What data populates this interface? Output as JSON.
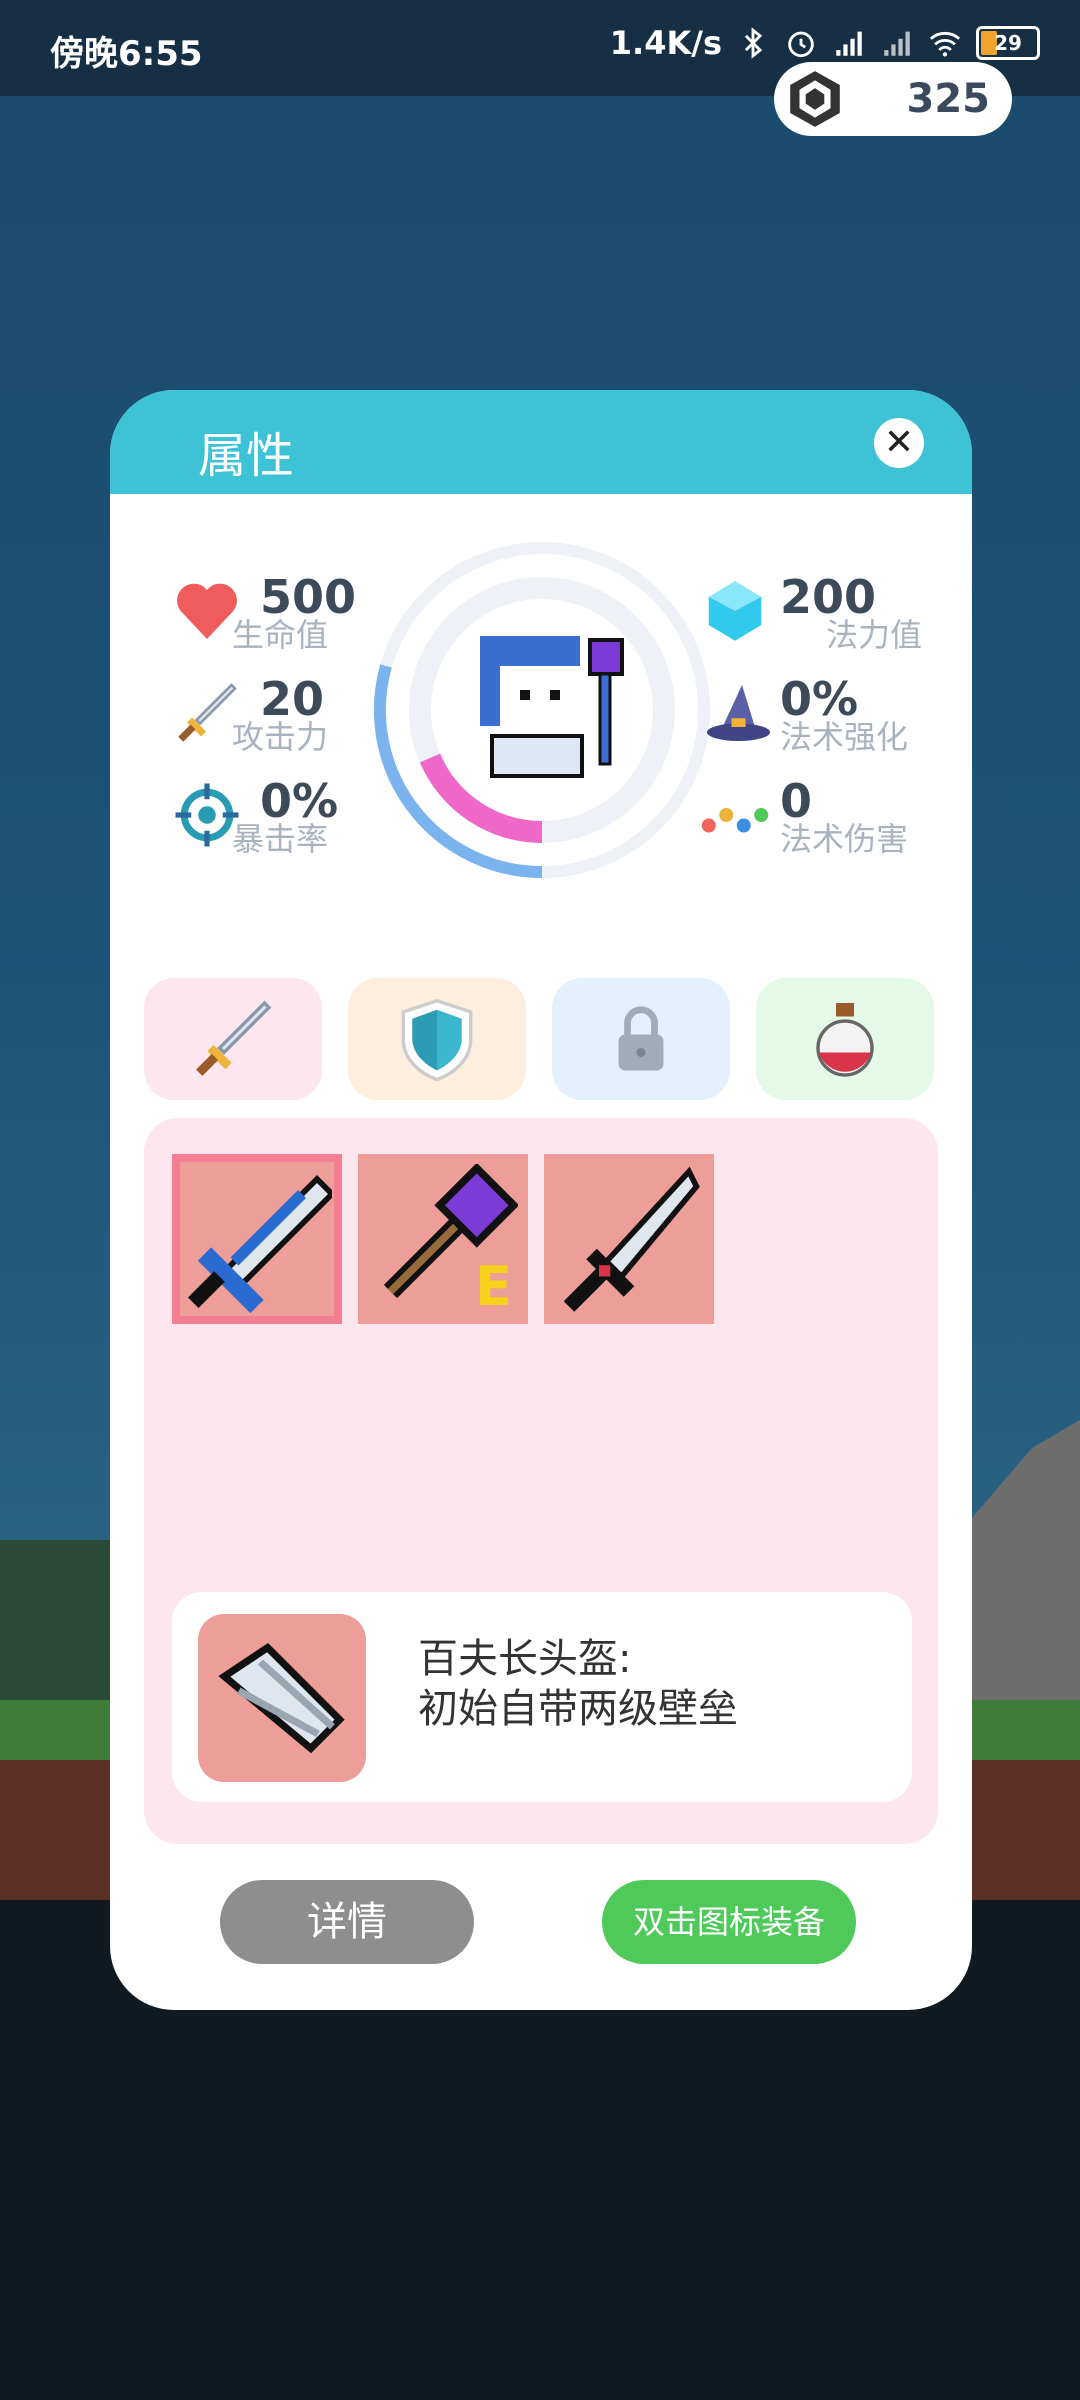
{
  "status_bar": {
    "time": "傍晚6:55",
    "network_speed": "1.4K/s",
    "battery": "29"
  },
  "currency": {
    "gem_count": "325",
    "icon": "gem-icon"
  },
  "dialog": {
    "title": "属性",
    "close_icon": "close-icon",
    "stats_left": [
      {
        "icon": "heart-icon",
        "value": "500",
        "label": "生命值"
      },
      {
        "icon": "sword-icon",
        "value": "20",
        "label": "攻击力"
      },
      {
        "icon": "crosshair-icon",
        "value": "0%",
        "label": "暴击率"
      }
    ],
    "stats_right": [
      {
        "icon": "mana-crystal-icon",
        "value": "200",
        "label": "法力值"
      },
      {
        "icon": "wizard-hat-icon",
        "value": "0%",
        "label": "法术强化"
      },
      {
        "icon": "spell-dots-icon",
        "value": "0",
        "label": "法术伤害"
      }
    ],
    "tabs": [
      {
        "icon": "sword-icon",
        "color": "#fde6ee"
      },
      {
        "icon": "shield-icon",
        "color": "#fdeedd"
      },
      {
        "icon": "lock-icon",
        "color": "#e4f0fd"
      },
      {
        "icon": "potion-icon",
        "color": "#e4f9e8"
      }
    ],
    "equipment_slots": [
      {
        "icon": "blue-sword-icon",
        "selected": true,
        "badge": ""
      },
      {
        "icon": "purple-staff-icon",
        "selected": false,
        "badge": "E"
      },
      {
        "icon": "katana-icon",
        "selected": false,
        "badge": ""
      }
    ],
    "selected_item": {
      "icon": "centurion-helmet-icon",
      "name": "百夫长头盔:",
      "description": "初始自带两级壁垒"
    },
    "buttons": {
      "detail": "详情",
      "equip": "双击图标装备"
    }
  }
}
